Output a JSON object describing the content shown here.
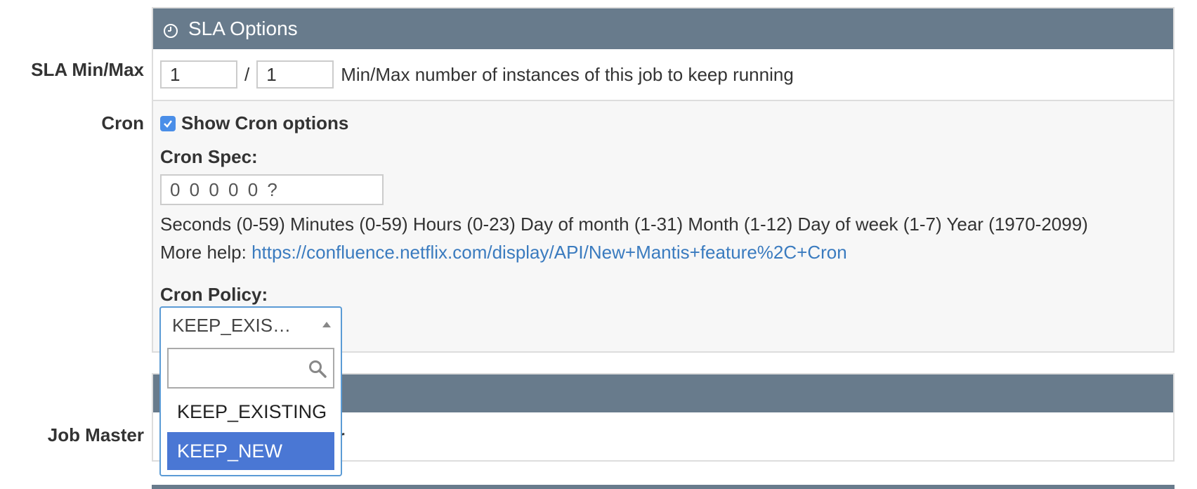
{
  "sla_panel": {
    "title": "SLA Options",
    "icon": "clock-icon"
  },
  "labels": {
    "sla_min_max": "SLA Min/Max",
    "cron": "Cron",
    "job_master": "Job Master"
  },
  "sla": {
    "min_value": "1",
    "separator": "/",
    "max_value": "1",
    "help_text": "Min/Max number of instances of this job to keep running"
  },
  "cron": {
    "show_options_label": "Show Cron options",
    "show_options_checked": true,
    "spec_label": "Cron Spec:",
    "spec_placeholder": "0 0 0 0 0 ?",
    "fields_help": "Seconds (0-59) Minutes (0-59) Hours (0-23) Day of month (1-31) Month (1-12) Day of week (1-7) Year (1970-2099)",
    "more_help_prefix": "More help:",
    "more_help_link": "https://confluence.netflix.com/display/API/New+Mantis+feature%2C+Cron",
    "policy_label": "Cron Policy:",
    "policy_selected": "KEEP_EXIS…",
    "policy_options": [
      "KEEP_EXISTING",
      "KEEP_NEW"
    ],
    "policy_highlighted": "KEEP_NEW"
  },
  "job_master": {
    "visible_text_suffix": "er"
  },
  "colors": {
    "panel_header": "#687b8c",
    "link": "#3a7bbf",
    "checkbox": "#4a8ee8",
    "highlight": "#4a77d4",
    "focus_border": "#5b9bd5"
  }
}
